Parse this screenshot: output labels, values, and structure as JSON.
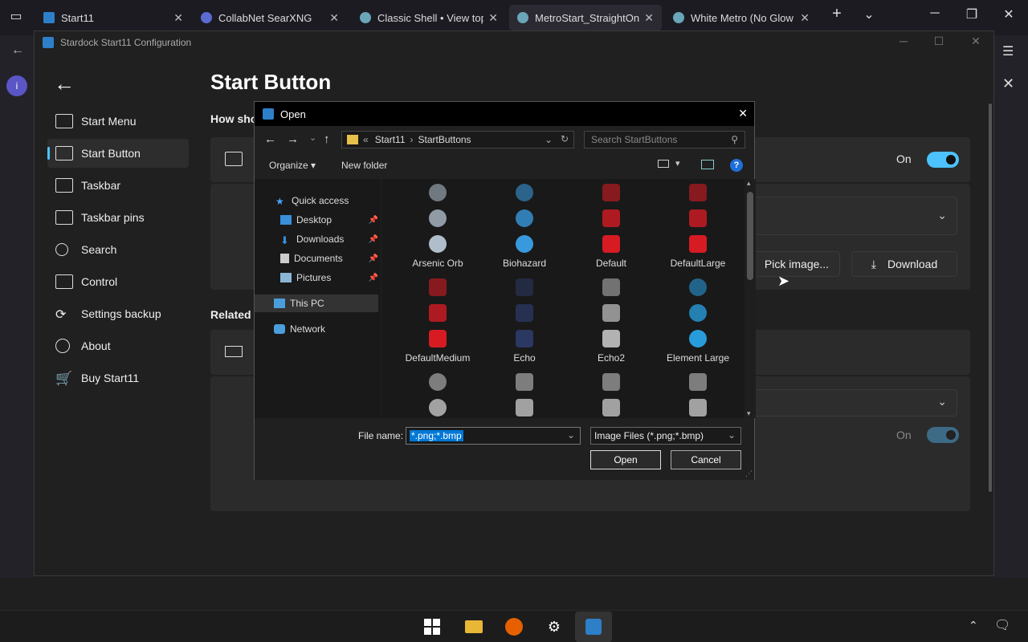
{
  "browser": {
    "tabs": [
      {
        "title": "Start11",
        "active": false
      },
      {
        "title": "CollabNet SearXNG",
        "active": false
      },
      {
        "title": "Classic Shell • View topic",
        "active": false
      },
      {
        "title": "MetroStart_StraightOn.pn",
        "active": true
      },
      {
        "title": "White Metro (No Glow Or",
        "active": false
      }
    ],
    "new_tab": "+",
    "tab_list": "⌄",
    "minimize": "─",
    "restore": "❐",
    "close": "✕",
    "menu": "☰"
  },
  "app": {
    "title": "Stardock Start11 Configuration",
    "page_title": "Start Button",
    "section1": "How sho",
    "section2": "Related",
    "nav": [
      {
        "label": "Start Menu",
        "icon": "start-menu-icon"
      },
      {
        "label": "Start Button",
        "icon": "start-button-icon",
        "selected": true
      },
      {
        "label": "Taskbar",
        "icon": "taskbar-icon"
      },
      {
        "label": "Taskbar pins",
        "icon": "taskbar-pins-icon"
      },
      {
        "label": "Search",
        "icon": "search-icon"
      },
      {
        "label": "Control",
        "icon": "control-icon"
      },
      {
        "label": "Settings backup",
        "icon": "settings-backup-icon"
      },
      {
        "label": "About",
        "icon": "about-icon"
      },
      {
        "label": "Buy Start11",
        "icon": "cart-icon"
      }
    ],
    "toggle1_label": "On",
    "toggle2_label": "On",
    "pick_image": "Pick image...",
    "download": "Download"
  },
  "dialog": {
    "title": "Open",
    "breadcrumb_prefix": "«",
    "breadcrumb": [
      "Start11",
      "StartButtons"
    ],
    "search_placeholder": "Search StartButtons",
    "organize": "Organize",
    "new_folder": "New folder",
    "help": "?",
    "nav_pane": [
      {
        "label": "Quick access",
        "pinned": false
      },
      {
        "label": "Desktop",
        "pinned": true
      },
      {
        "label": "Downloads",
        "pinned": true
      },
      {
        "label": "Documents",
        "pinned": true
      },
      {
        "label": "Pictures",
        "pinned": true
      },
      {
        "label": "This PC",
        "pinned": false
      },
      {
        "label": "Network",
        "pinned": false
      }
    ],
    "files": [
      {
        "name": "Arsenic Orb",
        "color": "#b8c7d6"
      },
      {
        "name": "Biohazard",
        "color": "#3aa0e8"
      },
      {
        "name": "Default",
        "color": "#e01b24"
      },
      {
        "name": "DefaultLarge",
        "color": "#e01b24"
      },
      {
        "name": "DefaultMedium",
        "color": "#e01b24"
      },
      {
        "name": "Echo",
        "color": "#2b3a66"
      },
      {
        "name": "Echo2",
        "color": "#bbbbbb"
      },
      {
        "name": "Element Large",
        "color": "#29a3e6"
      },
      {
        "name": "",
        "color": "#d0d0d0"
      },
      {
        "name": "",
        "color": "#cfcfcf"
      },
      {
        "name": "",
        "color": "#cfcfcf"
      },
      {
        "name": "",
        "color": "#cfcfcf"
      }
    ],
    "file_name_label": "File name:",
    "file_name_value": "*.png;*.bmp",
    "file_type": "Image Files (*.png;*.bmp)",
    "open": "Open",
    "cancel": "Cancel"
  },
  "taskbar": {
    "icons": [
      "windows-start-icon",
      "file-explorer-icon",
      "firefox-icon",
      "settings-icon",
      "start11-icon"
    ],
    "tray_up": "⌃",
    "notification": "🗨"
  },
  "colors": {
    "accent": "#4cc2ff",
    "start11_blue": "#2d7fc8"
  }
}
